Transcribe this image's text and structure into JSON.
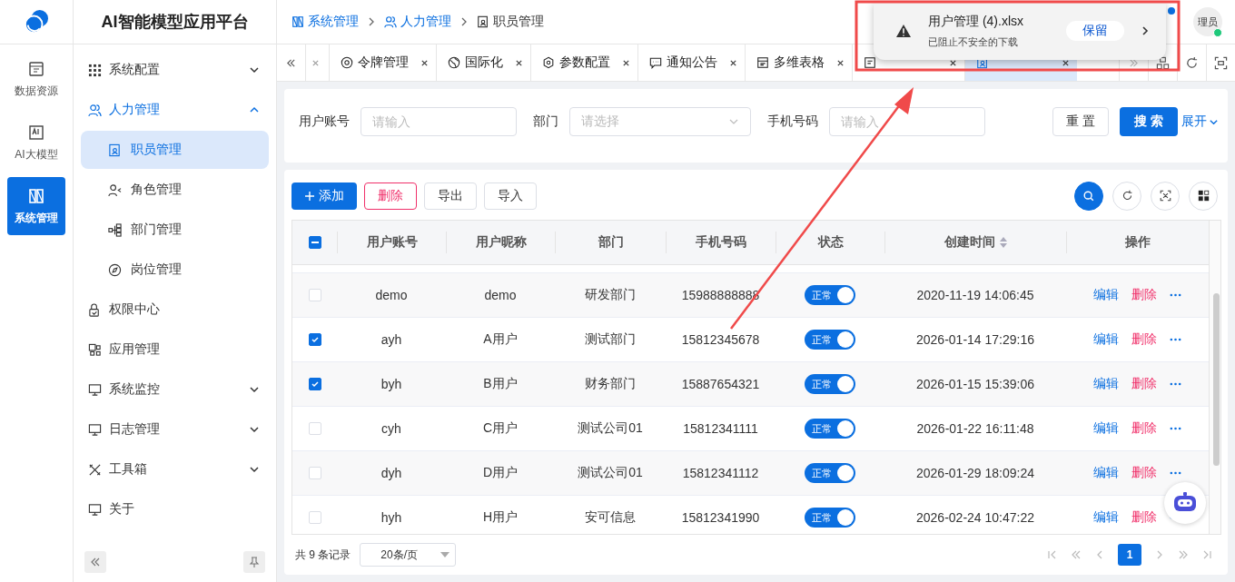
{
  "app": {
    "title": "AI智能模型应用平台"
  },
  "rail": [
    {
      "label": "数据资源",
      "selected": false
    },
    {
      "label": "AI大模型",
      "selected": false
    },
    {
      "label": "系统管理",
      "selected": true
    }
  ],
  "sidebar": {
    "items": [
      {
        "label": "系统配置",
        "expanded": false,
        "selected": false
      },
      {
        "label": "人力管理",
        "expanded": true,
        "selected": false,
        "children": [
          {
            "label": "职员管理",
            "selected": true
          },
          {
            "label": "角色管理",
            "selected": false
          },
          {
            "label": "部门管理",
            "selected": false
          },
          {
            "label": "岗位管理",
            "selected": false
          }
        ]
      },
      {
        "label": "权限中心",
        "selected": false
      },
      {
        "label": "应用管理",
        "selected": false
      },
      {
        "label": "系统监控",
        "expanded": false,
        "selected": false
      },
      {
        "label": "日志管理",
        "expanded": false,
        "selected": false
      },
      {
        "label": "工具箱",
        "expanded": false,
        "selected": false
      },
      {
        "label": "关于",
        "selected": false
      }
    ]
  },
  "breadcrumb": [
    "系统管理",
    "人力管理",
    "职员管理"
  ],
  "tabs": [
    {
      "label": "令牌管理",
      "selected": false
    },
    {
      "label": "国际化",
      "selected": false
    },
    {
      "label": "参数配置",
      "selected": false
    },
    {
      "label": "通知公告",
      "selected": false
    },
    {
      "label": "多维表格",
      "selected": false
    },
    {
      "selected": false
    },
    {
      "selected": true
    }
  ],
  "download_popup": {
    "filename": "用户管理 (4).xlsx",
    "message": "已阻止不安全的下载",
    "keep_button": "保留"
  },
  "user": {
    "avatar_text": "理员",
    "online": true,
    "notification": true
  },
  "search": {
    "fields": [
      {
        "kind": "input",
        "label": "用户账号",
        "placeholder": "请输入"
      },
      {
        "kind": "select",
        "label": "部门",
        "placeholder": "请选择"
      },
      {
        "kind": "input",
        "label": "手机号码",
        "placeholder": "请输入"
      }
    ],
    "reset_button": "重 置",
    "search_button": "搜 索",
    "expand_link": "展开"
  },
  "toolbar": {
    "add_button": "添加",
    "delete_button": "删除",
    "export_button": "导出",
    "import_button": "导入"
  },
  "table": {
    "select_all_partial": true,
    "columns": [
      {
        "label": "用户账号",
        "sortable": false
      },
      {
        "label": "用户昵称",
        "sortable": false
      },
      {
        "label": "部门",
        "sortable": false
      },
      {
        "label": "手机号码",
        "sortable": false
      },
      {
        "label": "状态",
        "sortable": false
      },
      {
        "label": "创建时间",
        "sortable": true
      },
      {
        "label": "操作",
        "sortable": false
      }
    ],
    "rows": [
      {
        "checked": false,
        "account": "demo",
        "nickname": "demo",
        "dept": "研发部门",
        "phone": "15988888888",
        "status": "正常",
        "status_on": true,
        "created": "2020-11-19 14:06:45",
        "actions": [
          "编辑",
          "删除"
        ]
      },
      {
        "checked": true,
        "account": "ayh",
        "nickname": "A用户",
        "dept": "测试部门",
        "phone": "15812345678",
        "status": "正常",
        "status_on": true,
        "created": "2026-01-14 17:29:16",
        "actions": [
          "编辑",
          "删除"
        ]
      },
      {
        "checked": true,
        "account": "byh",
        "nickname": "B用户",
        "dept": "财务部门",
        "phone": "15887654321",
        "status": "正常",
        "status_on": true,
        "created": "2026-01-15 15:39:06",
        "actions": [
          "编辑",
          "删除"
        ]
      },
      {
        "checked": false,
        "account": "cyh",
        "nickname": "C用户",
        "dept": "测试公司01",
        "phone": "15812341111",
        "status": "正常",
        "status_on": true,
        "created": "2026-01-22 16:11:48",
        "actions": [
          "编辑",
          "删除"
        ]
      },
      {
        "checked": false,
        "account": "dyh",
        "nickname": "D用户",
        "dept": "测试公司01",
        "phone": "15812341112",
        "status": "正常",
        "status_on": true,
        "created": "2026-01-29 18:09:24",
        "actions": [
          "编辑",
          "删除"
        ]
      },
      {
        "checked": false,
        "account": "hyh",
        "nickname": "H用户",
        "dept": "安可信息",
        "phone": "15812341990",
        "status": "正常",
        "status_on": true,
        "created": "2026-02-24 10:47:22",
        "actions": [
          "编辑",
          "删除"
        ]
      }
    ]
  },
  "pagination": {
    "total": "共 9 条记录",
    "page_size": "20条/页",
    "pages": [
      {
        "label": "1",
        "selected": true
      }
    ]
  }
}
